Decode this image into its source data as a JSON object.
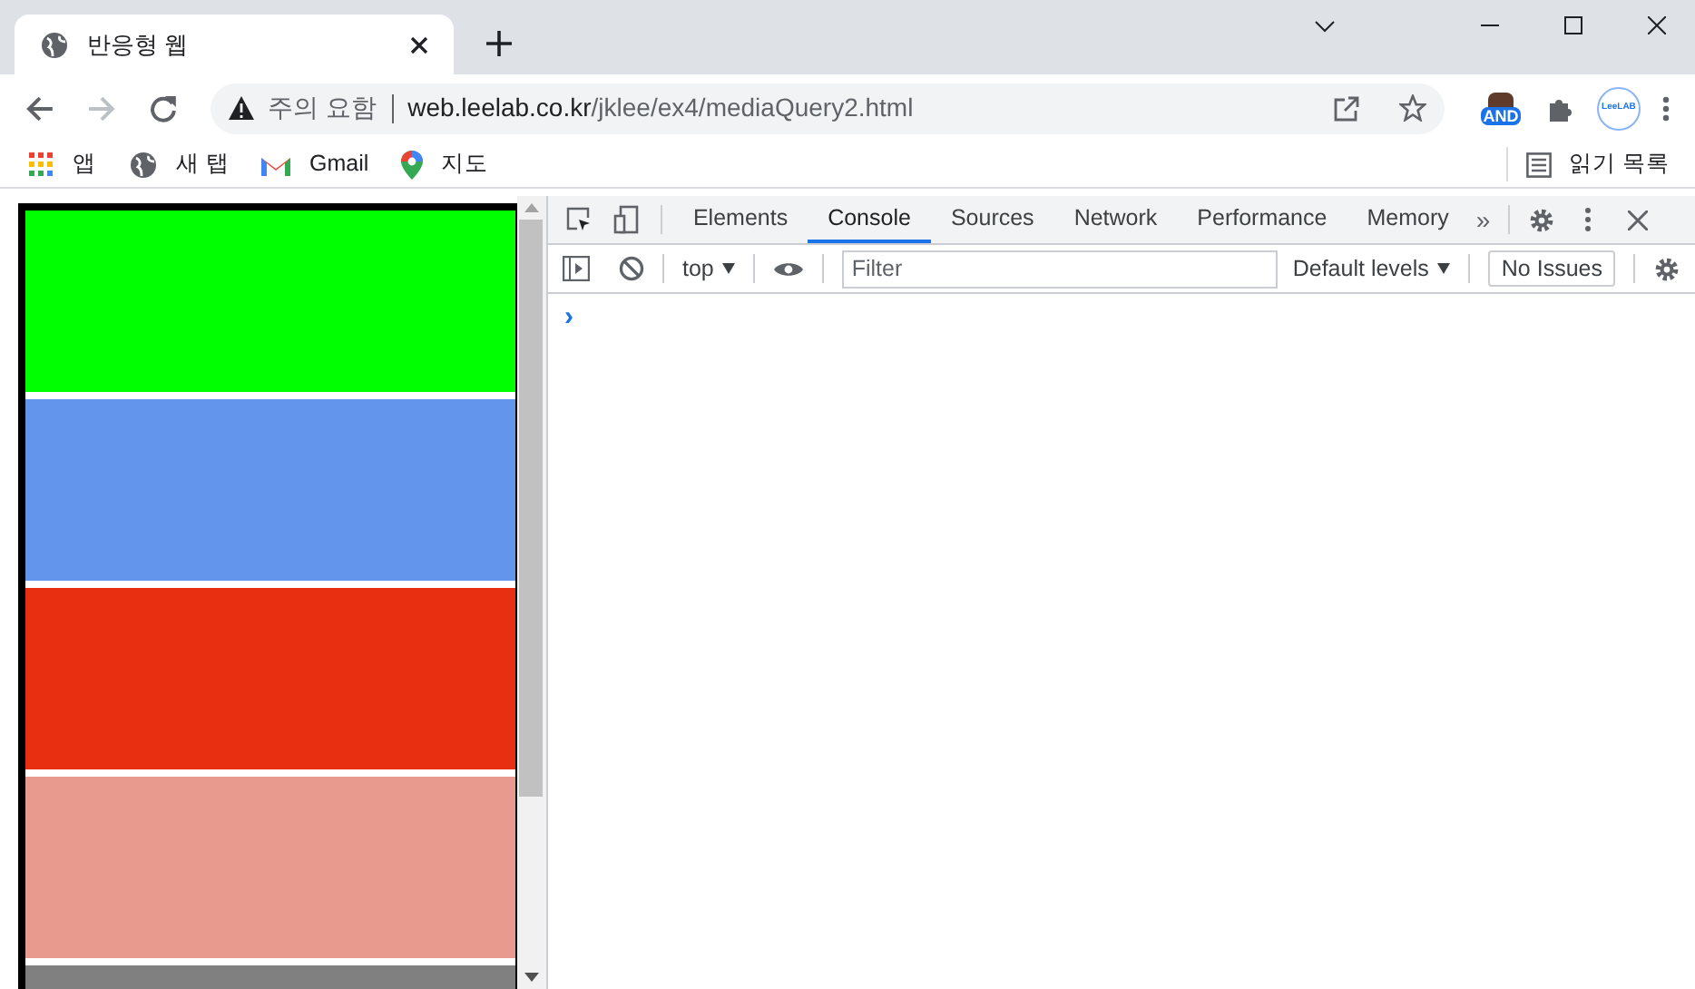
{
  "browser_tab": {
    "title": "반응형 웹",
    "selected": true
  },
  "address_bar": {
    "security_label": "주의 요함",
    "url_host": "web.leelab.co.kr",
    "url_path": "/jklee/ex4/mediaQuery2.html"
  },
  "extensions": [
    {
      "label": "AND"
    },
    {
      "label": "LeeLAB"
    }
  ],
  "bookmarks": [
    {
      "label": "앱",
      "kind": "apps"
    },
    {
      "label": "새 탭",
      "kind": "globe"
    },
    {
      "label": "Gmail",
      "kind": "gmail"
    },
    {
      "label": "지도",
      "kind": "maps"
    }
  ],
  "reading_list": "읽기 목록",
  "page_blocks": [
    {
      "color": "#00ff00"
    },
    {
      "color": "#6495ed"
    },
    {
      "color": "#e92f12"
    },
    {
      "color": "#e89a8f"
    },
    {
      "color": "#808080"
    }
  ],
  "devtools": {
    "tabs": [
      {
        "label": "Elements",
        "selected": false
      },
      {
        "label": "Console",
        "selected": true
      },
      {
        "label": "Sources",
        "selected": false
      },
      {
        "label": "Network",
        "selected": false
      },
      {
        "label": "Performance",
        "selected": false
      },
      {
        "label": "Memory",
        "selected": false
      }
    ],
    "more_tabs": "»",
    "context": "top",
    "filter_placeholder": "Filter",
    "levels": "Default levels",
    "issues": "No Issues",
    "prompt": "›"
  }
}
